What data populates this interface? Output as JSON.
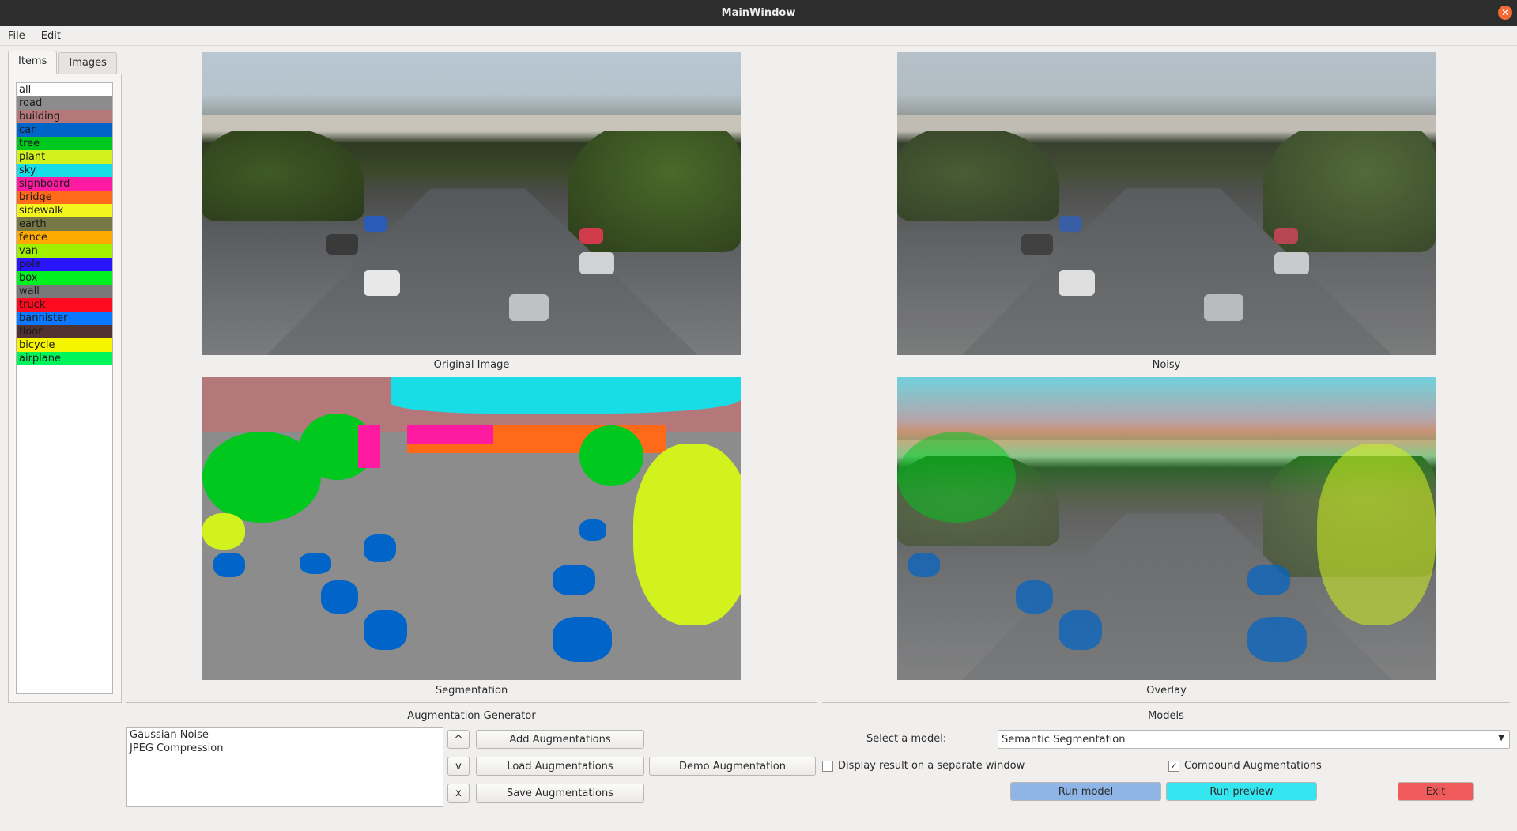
{
  "window": {
    "title": "MainWindow"
  },
  "menubar": {
    "items": [
      "File",
      "Edit"
    ]
  },
  "left_panel": {
    "tabs": [
      {
        "label": "Items",
        "active": true
      },
      {
        "label": "Images",
        "active": false
      }
    ],
    "classes": [
      {
        "label": "all",
        "color": "#ffffff"
      },
      {
        "label": "road",
        "color": "#8c8c8c"
      },
      {
        "label": "building",
        "color": "#b4787a"
      },
      {
        "label": "car",
        "color": "#0064c8"
      },
      {
        "label": "tree",
        "color": "#00c81e"
      },
      {
        "label": "plant",
        "color": "#d2f21e"
      },
      {
        "label": "sky",
        "color": "#19dde6"
      },
      {
        "label": "signboard",
        "color": "#ff1aa2"
      },
      {
        "label": "bridge",
        "color": "#ff6a1a"
      },
      {
        "label": "sidewalk",
        "color": "#f5f51e"
      },
      {
        "label": "earth",
        "color": "#787846"
      },
      {
        "label": "fence",
        "color": "#ffaa00"
      },
      {
        "label": "van",
        "color": "#a0f000"
      },
      {
        "label": "pole",
        "color": "#2814ff"
      },
      {
        "label": "box",
        "color": "#00f020"
      },
      {
        "label": "wall",
        "color": "#787878"
      },
      {
        "label": "truck",
        "color": "#ff0a1e"
      },
      {
        "label": "bannister",
        "color": "#0a78ff"
      },
      {
        "label": "floor",
        "color": "#503232"
      },
      {
        "label": "bicycle",
        "color": "#f5f500"
      },
      {
        "label": "airplane",
        "color": "#00f55a"
      }
    ]
  },
  "images": {
    "original_caption": "Original Image",
    "noisy_caption": "Noisy",
    "segmentation_caption": "Segmentation",
    "overlay_caption": "Overlay"
  },
  "augmentation": {
    "title": "Augmentation Generator",
    "list": [
      "Gaussian Noise",
      "JPEG Compression"
    ],
    "move_up_label": "^",
    "move_down_label": "v",
    "remove_label": "x",
    "add_label": "Add Augmentations",
    "load_label": "Load Augmentations",
    "save_label": "Save Augmentations",
    "demo_label": "Demo Augmentation"
  },
  "models": {
    "title": "Models",
    "select_label": "Select a model:",
    "selected_model": "Semantic Segmentation",
    "separate_window_label": "Display result on a separate window",
    "separate_window_checked": false,
    "compound_label": "Compound Augmentations",
    "compound_checked": true,
    "run_model_label": "Run model",
    "run_preview_label": "Run preview",
    "exit_label": "Exit"
  },
  "colors": {
    "run_model": "#8fb4e6",
    "run_preview": "#33e6f0",
    "exit": "#f05a5a"
  }
}
